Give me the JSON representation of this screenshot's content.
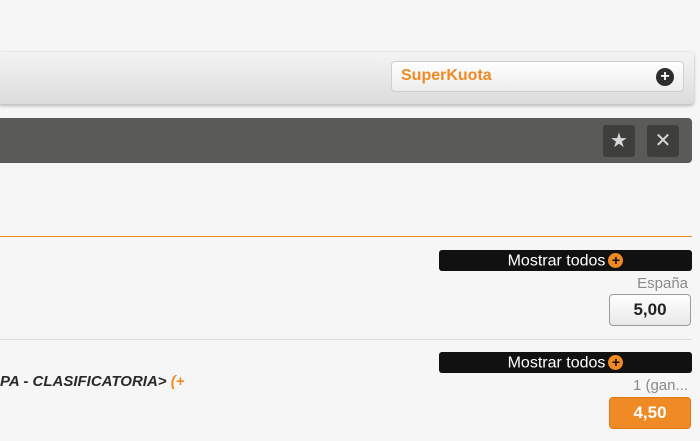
{
  "superkuota": {
    "label": "SuperKuota",
    "expand_icon": "plus-circle-icon"
  },
  "toolbar": {
    "favorite_icon": "star-icon",
    "close_icon": "close-icon"
  },
  "markets": [
    {
      "show_all_label": "Mostrar todos",
      "odd_label": "España",
      "odd_value": "5,00"
    },
    {
      "show_all_label": "Mostrar todos",
      "event_title": "PA - CLASIFICATORIA>",
      "event_title_tail": " (+",
      "odd_label": "1 (gan...",
      "odd_value": "4,50"
    }
  ],
  "colors": {
    "accent": "#f08a24",
    "dark_bar": "#5a5a58",
    "black": "#111111"
  }
}
